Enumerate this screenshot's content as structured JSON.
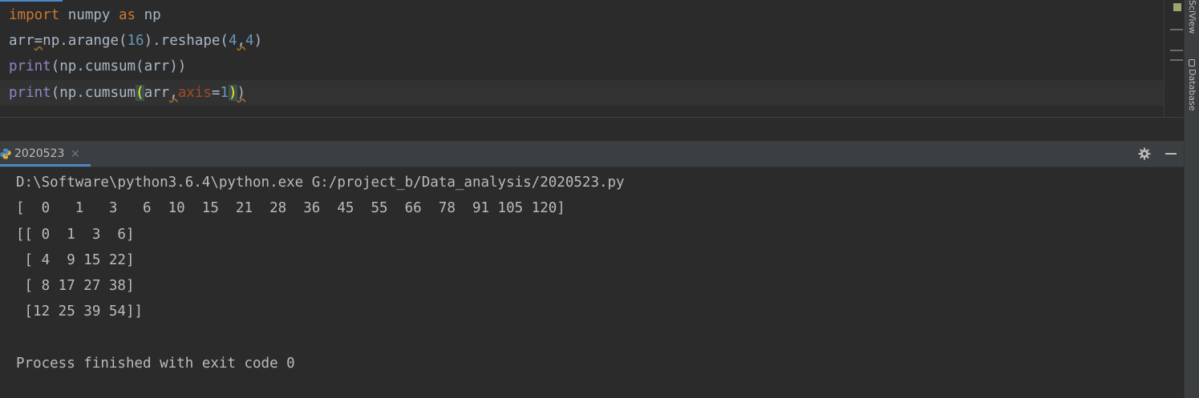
{
  "editor": {
    "line1": {
      "kw_import": "import",
      "module": " numpy ",
      "kw_as": "as",
      "alias": " np"
    },
    "line2": {
      "var": "arr",
      "eq": "=",
      "pre": "np.arange(",
      "n16": "16",
      "mid": ").reshape(",
      "n4a": "4",
      "comma": ",",
      "n4b": "4",
      "close": ")"
    },
    "line3": {
      "print": "print",
      "rest": "(np.cumsum(arr))"
    },
    "line4": {
      "print": "print",
      "pre": "(np.cumsum",
      "open": "(",
      "arr": "arr",
      "comma": ",",
      "param": "axis",
      "eq": "=",
      "one": "1",
      "close_hl": ")",
      "close": ")"
    }
  },
  "sidebar_right": {
    "sciview_label": "SciView",
    "database_label": "Database"
  },
  "run_panel": {
    "tab_label": "2020523",
    "close_glyph": "×",
    "console_lines": [
      "D:\\Software\\python3.6.4\\python.exe G:/project_b/Data_analysis/2020523.py",
      "[  0   1   3   6  10  15  21  28  36  45  55  66  78  91 105 120]",
      "[[ 0  1  3  6]",
      " [ 4  9 15 22]",
      " [ 8 17 27 38]",
      " [12 25 39 54]]",
      "",
      "Process finished with exit code 0"
    ]
  },
  "colors": {
    "background": "#2b2b2b",
    "keyword": "#cc7832",
    "number": "#6897bb",
    "builtin": "#8888c6",
    "parameter": "#aa4926",
    "text": "#a9b7c6",
    "accent": "#4a88c7"
  },
  "icons": {
    "run_tab": "python-icon",
    "settings": "gear-icon",
    "minimize": "minimize-icon"
  }
}
